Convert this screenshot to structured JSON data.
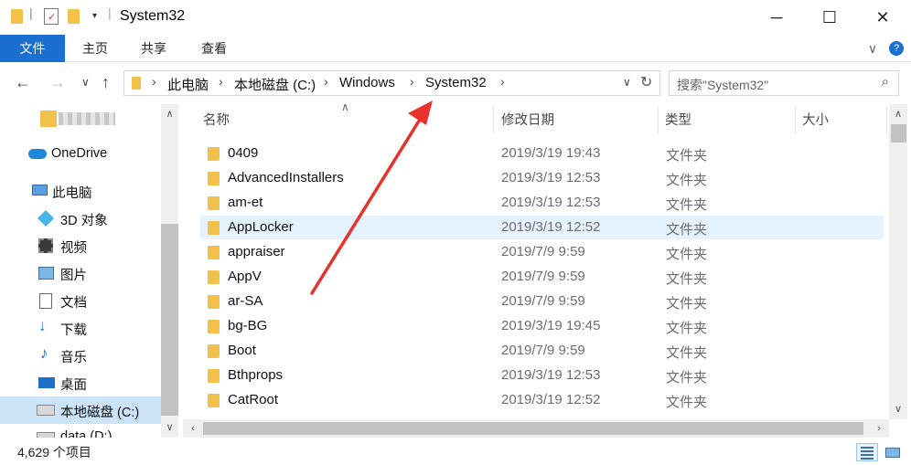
{
  "window": {
    "title": "System32",
    "minimize": "─",
    "maximize": "☐",
    "close": "✕"
  },
  "ribbon": {
    "tabs": [
      "文件",
      "主页",
      "共享",
      "查看"
    ],
    "expand": "∨",
    "help": "?"
  },
  "address": {
    "crumbs": [
      "此电脑",
      "本地磁盘 (C:)",
      "Windows",
      "System32"
    ],
    "search_placeholder": "搜索\"System32\""
  },
  "sidebar": {
    "items": [
      {
        "label": "",
        "icon": "folder-icon"
      },
      {
        "label": "OneDrive",
        "icon": "cloud-icon"
      },
      {
        "label": "此电脑",
        "icon": "computer-icon"
      },
      {
        "label": "3D 对象",
        "icon": "cube-icon"
      },
      {
        "label": "视频",
        "icon": "video-icon"
      },
      {
        "label": "图片",
        "icon": "picture-icon"
      },
      {
        "label": "文档",
        "icon": "document-icon"
      },
      {
        "label": "下载",
        "icon": "download-icon"
      },
      {
        "label": "音乐",
        "icon": "music-icon"
      },
      {
        "label": "桌面",
        "icon": "desktop-icon"
      },
      {
        "label": "本地磁盘 (C:)",
        "icon": "drive-icon"
      },
      {
        "label": "data (D:)",
        "icon": "drive-icon"
      }
    ],
    "selected_index": 10
  },
  "columns": {
    "name": "名称",
    "date": "修改日期",
    "type": "类型",
    "size": "大小"
  },
  "files": [
    {
      "name": "0409",
      "date": "2019/3/19 19:43",
      "type": "文件夹"
    },
    {
      "name": "AdvancedInstallers",
      "date": "2019/3/19 12:53",
      "type": "文件夹"
    },
    {
      "name": "am-et",
      "date": "2019/3/19 12:53",
      "type": "文件夹"
    },
    {
      "name": "AppLocker",
      "date": "2019/3/19 12:52",
      "type": "文件夹"
    },
    {
      "name": "appraiser",
      "date": "2019/7/9 9:59",
      "type": "文件夹"
    },
    {
      "name": "AppV",
      "date": "2019/7/9 9:59",
      "type": "文件夹"
    },
    {
      "name": "ar-SA",
      "date": "2019/7/9 9:59",
      "type": "文件夹"
    },
    {
      "name": "bg-BG",
      "date": "2019/3/19 19:45",
      "type": "文件夹"
    },
    {
      "name": "Boot",
      "date": "2019/7/9 9:59",
      "type": "文件夹"
    },
    {
      "name": "Bthprops",
      "date": "2019/3/19 12:53",
      "type": "文件夹"
    },
    {
      "name": "CatRoot",
      "date": "2019/3/19 12:52",
      "type": "文件夹"
    }
  ],
  "highlighted_row": 3,
  "status": {
    "item_count": "4,629 个项目"
  },
  "colors": {
    "accent": "#1a6fd0",
    "selected_bg": "#cce4f7",
    "hover_bg": "#e5f3ff",
    "annotation": "#e8322b"
  }
}
